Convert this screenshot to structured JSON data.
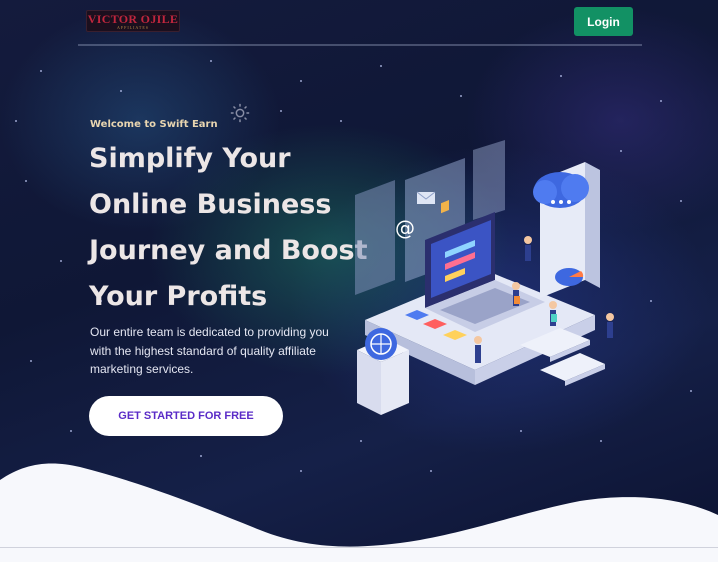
{
  "navbar": {
    "logo_text": "VICTOR OJILE",
    "logo_tagline": "AFFILIATES",
    "login_label": "Login"
  },
  "hero": {
    "eyebrow": "Welcome to Swift Earn",
    "headline_lines": [
      "Simplify Your",
      "Online Business",
      "Journey and Boost",
      "Your Profits"
    ],
    "description": "Our entire team is dedicated to providing you with the highest standard of quality affiliate marketing services.",
    "cta_label": "GET STARTED FOR FREE"
  },
  "icons": {
    "gear": "gear-icon",
    "illustration": "isometric-laptop-illustration"
  },
  "colors": {
    "login_button": "#129164",
    "cta_text": "#5a2bc7",
    "logo_text": "#c0263e",
    "eyebrow": "#e8d5b0",
    "background": "#141b3d"
  }
}
